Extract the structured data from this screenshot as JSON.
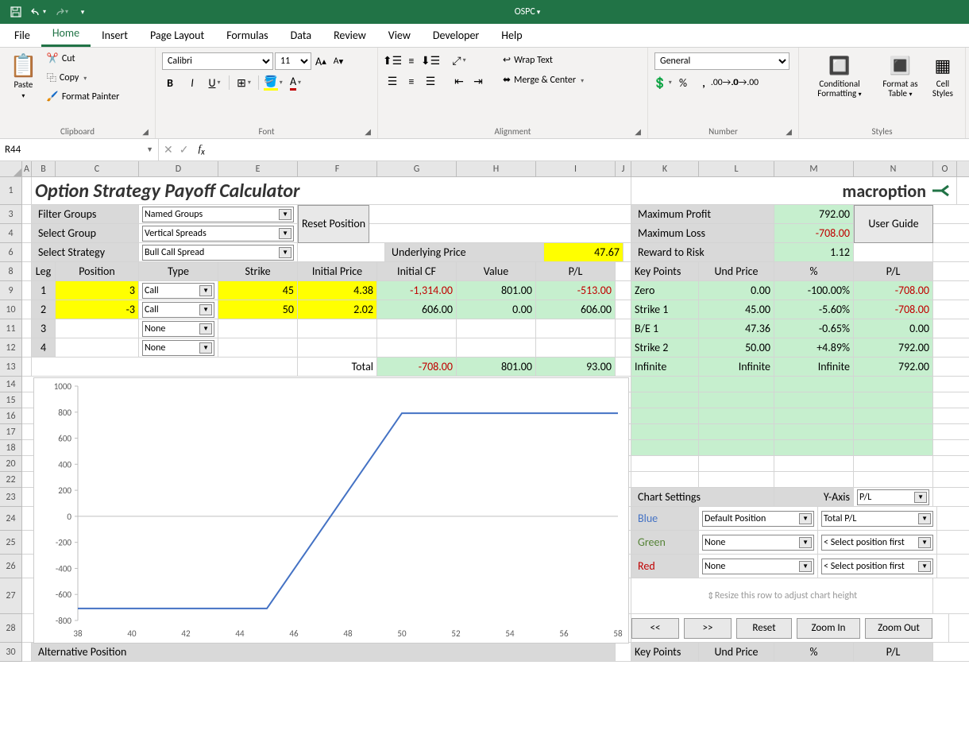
{
  "titlebar": {
    "title": "OSPC"
  },
  "ribbon": {
    "tabs": [
      "File",
      "Home",
      "Insert",
      "Page Layout",
      "Formulas",
      "Data",
      "Review",
      "View",
      "Developer",
      "Help"
    ],
    "active": 1,
    "clipboard": {
      "paste": "Paste",
      "cut": "Cut",
      "copy": "Copy",
      "painter": "Format Painter",
      "label": "Clipboard"
    },
    "font": {
      "name": "Calibri",
      "size": "11",
      "label": "Font"
    },
    "alignment": {
      "wrap": "Wrap Text",
      "merge": "Merge & Center",
      "label": "Alignment"
    },
    "number": {
      "format": "General",
      "label": "Number"
    },
    "styles": {
      "cond": "Conditional Formatting",
      "table": "Format as Table",
      "cell": "Cell Styles",
      "label": "Styles"
    }
  },
  "namebox": "R44",
  "sheet": {
    "title": "Option Strategy Payoff Calculator",
    "logo": "macroption",
    "filterGroups": {
      "label": "Filter Groups",
      "value": "Named Groups"
    },
    "selectGroup": {
      "label": "Select Group",
      "value": "Vertical Spreads"
    },
    "selectStrategy": {
      "label": "Select Strategy",
      "value": "Bull Call Spread"
    },
    "resetPos": "Reset Position",
    "userGuide": "User Guide",
    "underlyingLabel": "Underlying Price",
    "underlyingValue": "47.67",
    "maxProfit": {
      "label": "Maximum Profit",
      "value": "792.00"
    },
    "maxLoss": {
      "label": "Maximum Loss",
      "value": "-708.00"
    },
    "rewardRisk": {
      "label": "Reward to Risk",
      "value": "1.12"
    },
    "legHead": [
      "Leg",
      "Position",
      "Type",
      "Strike",
      "Initial Price",
      "Initial CF",
      "Value",
      "P/L"
    ],
    "legs": [
      {
        "n": "1",
        "pos": "3",
        "type": "Call",
        "strike": "45",
        "price": "4.38",
        "cf": "-1,314.00",
        "value": "801.00",
        "pl": "-513.00"
      },
      {
        "n": "2",
        "pos": "-3",
        "type": "Call",
        "strike": "50",
        "price": "2.02",
        "cf": "606.00",
        "value": "0.00",
        "pl": "606.00"
      },
      {
        "n": "3",
        "pos": "",
        "type": "None",
        "strike": "",
        "price": "",
        "cf": "",
        "value": "",
        "pl": ""
      },
      {
        "n": "4",
        "pos": "",
        "type": "None",
        "strike": "",
        "price": "",
        "cf": "",
        "value": "",
        "pl": ""
      }
    ],
    "total": {
      "label": "Total",
      "cf": "-708.00",
      "value": "801.00",
      "pl": "93.00"
    },
    "kpHead": [
      "Key Points",
      "Und Price",
      "%",
      "P/L"
    ],
    "kp": [
      {
        "name": "Zero",
        "und": "0.00",
        "pct": "-100.00%",
        "pl": "-708.00"
      },
      {
        "name": "Strike 1",
        "und": "45.00",
        "pct": "-5.60%",
        "pl": "-708.00"
      },
      {
        "name": "B/E 1",
        "und": "47.36",
        "pct": "-0.65%",
        "pl": "0.00"
      },
      {
        "name": "Strike 2",
        "und": "50.00",
        "pct": "+4.89%",
        "pl": "792.00"
      },
      {
        "name": "Infinite",
        "und": "Infinite",
        "pct": "Infinite",
        "pl": "792.00"
      }
    ],
    "chartSettings": {
      "label": "Chart Settings",
      "yaxis": "Y-Axis",
      "yaxisVal": "P/L"
    },
    "series": {
      "blue": {
        "label": "Blue",
        "pos": "Default Position",
        "pl": "Total P/L"
      },
      "green": {
        "label": "Green",
        "pos": "None",
        "pl": "< Select position first"
      },
      "red": {
        "label": "Red",
        "pos": "None",
        "pl": "< Select position first"
      }
    },
    "resizeHint": "Resize this row to adjust chart height",
    "navBtns": [
      "<<",
      ">>",
      "Reset",
      "Zoom In",
      "Zoom Out"
    ],
    "altPos": "Alternative Position",
    "kpHead2": [
      "Key Points",
      "Und Price",
      "%",
      "P/L"
    ]
  },
  "chart_data": {
    "type": "line",
    "x": [
      38,
      40,
      42,
      44,
      45,
      50,
      52,
      54,
      56,
      58
    ],
    "y": [
      -708,
      -708,
      -708,
      -708,
      -708,
      792,
      792,
      792,
      792,
      792
    ],
    "xlabel": "",
    "ylabel": "",
    "xlim": [
      38,
      58
    ],
    "ylim": [
      -800,
      1000
    ],
    "yticks": [
      -800,
      -600,
      -400,
      -200,
      0,
      200,
      400,
      600,
      800,
      1000
    ],
    "xticks": [
      38,
      40,
      42,
      44,
      46,
      48,
      50,
      52,
      54,
      56,
      58
    ]
  }
}
